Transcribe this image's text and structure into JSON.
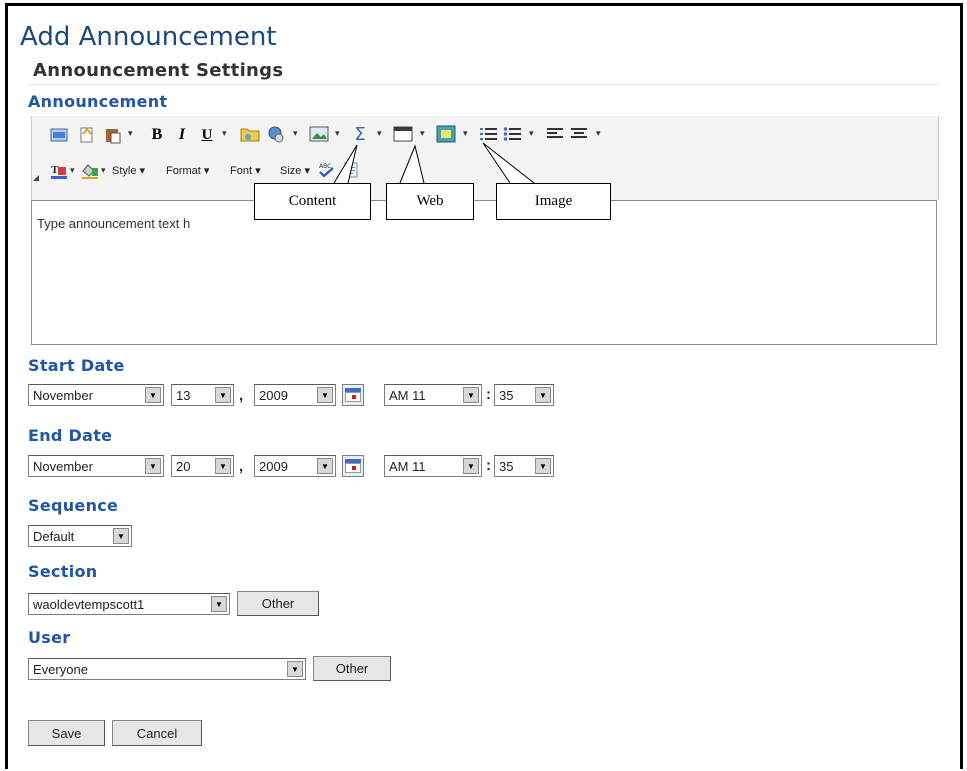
{
  "page": {
    "title": "Add Announcement",
    "subtitle": "Announcement Settings"
  },
  "editor": {
    "label": "Announcement",
    "placeholder_text": "Type announcement text h",
    "toolbar_row2": {
      "style_label": "Style",
      "format_label": "Format",
      "font_label": "Font",
      "size_label": "Size"
    }
  },
  "callouts": {
    "content": "Content",
    "web": "Web",
    "image": "Image"
  },
  "start_date": {
    "label": "Start Date",
    "month": "November",
    "day": "13",
    "year": "2009",
    "hour": "AM 11",
    "minute": "35"
  },
  "end_date": {
    "label": "End Date",
    "month": "November",
    "day": "20",
    "year": "2009",
    "hour": "AM 11",
    "minute": "35"
  },
  "separators": {
    "comma": ",",
    "colon": ":"
  },
  "sequence": {
    "label": "Sequence",
    "value": "Default"
  },
  "section": {
    "label": "Section",
    "value": "waoldevtempscott1",
    "other_label": "Other"
  },
  "user": {
    "label": "User",
    "value": "Everyone",
    "other_label": "Other"
  },
  "actions": {
    "save_label": "Save",
    "cancel_label": "Cancel"
  }
}
